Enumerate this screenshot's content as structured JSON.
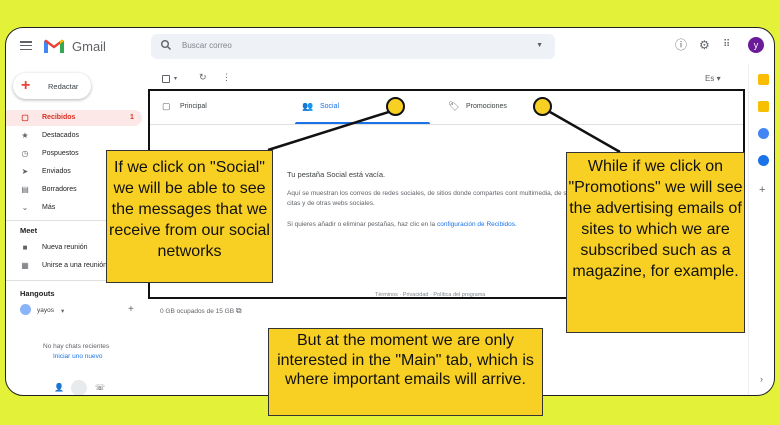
{
  "header": {
    "app_name": "Gmail",
    "search_placeholder": "Buscar correo",
    "avatar_letter": "y"
  },
  "sidebar": {
    "compose_label": "Redactar",
    "items": [
      {
        "label": "Recibidos",
        "count": "1",
        "icon": "inbox-icon"
      },
      {
        "label": "Destacados",
        "icon": "star-icon"
      },
      {
        "label": "Pospuestos",
        "icon": "clock-icon"
      },
      {
        "label": "Enviados",
        "icon": "send-icon"
      },
      {
        "label": "Borradores",
        "icon": "draft-icon"
      },
      {
        "label": "Más",
        "icon": "chevron-down-icon"
      }
    ],
    "meet": {
      "title": "Meet",
      "items": [
        {
          "label": "Nueva reunión",
          "icon": "video-icon"
        },
        {
          "label": "Unirse a una reunión",
          "icon": "keyboard-icon"
        }
      ]
    },
    "hangouts": {
      "title": "Hangouts",
      "user": "yayos",
      "no_chats": "No hay chats recientes",
      "start_new": "Iniciar uno nuevo"
    }
  },
  "toolbar": {
    "lang": "Es"
  },
  "tabs": [
    {
      "label": "Principal",
      "icon": "inbox-tab-icon"
    },
    {
      "label": "Social",
      "icon": "people-icon",
      "active": true
    },
    {
      "label": "Promociones",
      "icon": "tag-icon"
    }
  ],
  "empty_state": {
    "title": "Tu pestaña Social está vacía.",
    "description": "Aquí se muestran los correos de redes sociales, de sitios donde compartes cont multimedia, de servicios de citas y de otras webs sociales.",
    "hint_prefix": "Si quieres añadir o eliminar pestañas, haz clic en la ",
    "hint_link": "configuración de Recibidos",
    "hint_suffix": "."
  },
  "footer_text": "Términos · Privacidad · Política del programa",
  "storage": "0 GB ocupados de 15 GB",
  "annotations": {
    "social": "If we click on \"Social\" we will be able to see the messages that we receive from our social networks",
    "promotions": "While if we click on \"Promotions\" we will see the advertising emails of sites to which we are subscribed such as a magazine, for example.",
    "main": "But at the moment we are only interested in the \"Main\" tab, which is where important emails will arrive."
  },
  "colors": {
    "background": "#e3f239",
    "annotation": "#f8d023",
    "gmail_red": "#d93025",
    "active_blue": "#1a73e8"
  }
}
